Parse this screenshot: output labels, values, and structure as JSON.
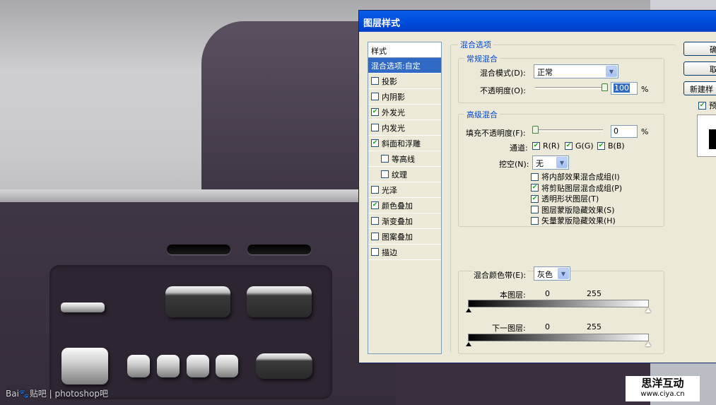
{
  "dialog": {
    "title": "图层样式"
  },
  "style_list": {
    "header": "样式",
    "items": [
      {
        "label": "混合选项:自定",
        "checkbox": false,
        "checked": false,
        "selected": true,
        "indent": false
      },
      {
        "label": "投影",
        "checkbox": true,
        "checked": false,
        "selected": false,
        "indent": false
      },
      {
        "label": "内阴影",
        "checkbox": true,
        "checked": false,
        "selected": false,
        "indent": false
      },
      {
        "label": "外发光",
        "checkbox": true,
        "checked": true,
        "selected": false,
        "indent": false
      },
      {
        "label": "内发光",
        "checkbox": true,
        "checked": false,
        "selected": false,
        "indent": false
      },
      {
        "label": "斜面和浮雕",
        "checkbox": true,
        "checked": true,
        "selected": false,
        "indent": false
      },
      {
        "label": "等高线",
        "checkbox": true,
        "checked": false,
        "selected": false,
        "indent": true
      },
      {
        "label": "纹理",
        "checkbox": true,
        "checked": false,
        "selected": false,
        "indent": true
      },
      {
        "label": "光泽",
        "checkbox": true,
        "checked": false,
        "selected": false,
        "indent": false
      },
      {
        "label": "颜色叠加",
        "checkbox": true,
        "checked": true,
        "selected": false,
        "indent": false
      },
      {
        "label": "渐变叠加",
        "checkbox": true,
        "checked": false,
        "selected": false,
        "indent": false
      },
      {
        "label": "图案叠加",
        "checkbox": true,
        "checked": false,
        "selected": false,
        "indent": false
      },
      {
        "label": "描边",
        "checkbox": true,
        "checked": false,
        "selected": false,
        "indent": false
      }
    ]
  },
  "blend_options": {
    "title": "混合选项",
    "general": {
      "title": "常规混合",
      "blend_mode_label": "混合模式(D):",
      "blend_mode_value": "正常",
      "opacity_label": "不透明度(O):",
      "opacity_value": "100",
      "opacity_unit": "%",
      "opacity_level": 1.0
    },
    "advanced": {
      "title": "高级混合",
      "fill_opacity_label": "填充不透明度(F):",
      "fill_opacity_value": "0",
      "fill_opacity_unit": "%",
      "fill_opacity_level": 0.0,
      "channels_label": "通道:",
      "channels": [
        {
          "label": "R(R)",
          "checked": true
        },
        {
          "label": "G(G)",
          "checked": true
        },
        {
          "label": "B(B)",
          "checked": true
        }
      ],
      "knockout_label": "挖空(N):",
      "knockout_value": "无",
      "options": [
        {
          "label": "将内部效果混合成组(I)",
          "checked": false
        },
        {
          "label": "将剪贴图层混合成组(P)",
          "checked": true
        },
        {
          "label": "透明形状图层(T)",
          "checked": true
        },
        {
          "label": "图层蒙版隐藏效果(S)",
          "checked": false
        },
        {
          "label": "矢量蒙版隐藏效果(H)",
          "checked": false
        }
      ]
    },
    "blend_if": {
      "label": "混合颜色带(E):",
      "value": "灰色",
      "this_layer_label": "本图层:",
      "this_layer_min": "0",
      "this_layer_max": "255",
      "underlying_label": "下一图层:",
      "underlying_min": "0",
      "underlying_max": "255"
    }
  },
  "buttons": {
    "ok": "确",
    "cancel": "取",
    "new_style": "新建样",
    "preview_label": "预",
    "preview_checked": true
  },
  "watermarks": {
    "left": "Bai🐾贴吧 | photoshop吧",
    "right_title": "思洋互动",
    "right_url": "www.ciya.cn"
  }
}
